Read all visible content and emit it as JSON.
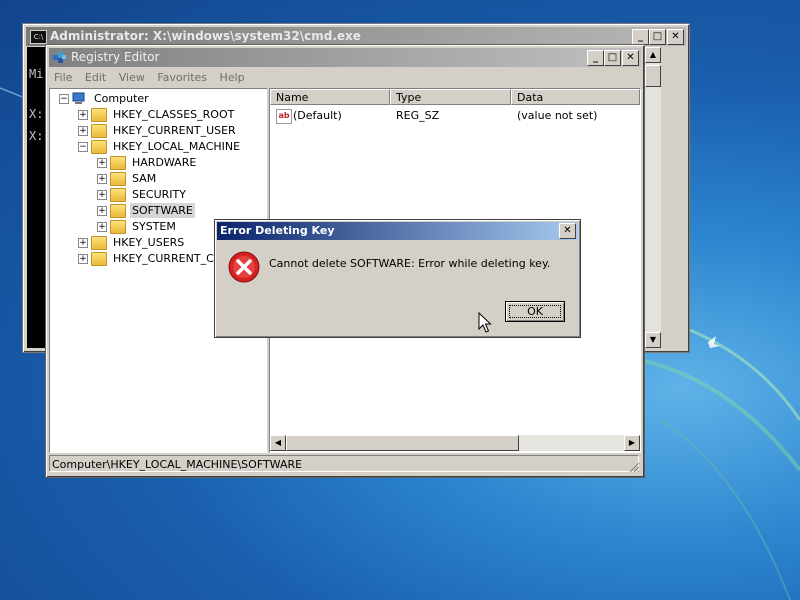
{
  "cmd": {
    "title": "Administrator: X:\\windows\\system32\\cmd.exe",
    "icon": "cmd-icon",
    "console_lines": [
      "Mi",
      "",
      "X:",
      "",
      "X:"
    ]
  },
  "regedit": {
    "title": "Registry Editor",
    "menu": [
      "File",
      "Edit",
      "View",
      "Favorites",
      "Help"
    ],
    "tree": [
      {
        "label": "Computer"
      },
      {
        "label": "HKEY_CLASSES_ROOT"
      },
      {
        "label": "HKEY_CURRENT_USER"
      },
      {
        "label": "HKEY_LOCAL_MACHINE"
      },
      {
        "label": "HARDWARE"
      },
      {
        "label": "SAM"
      },
      {
        "label": "SECURITY"
      },
      {
        "label": "SOFTWARE"
      },
      {
        "label": "SYSTEM"
      },
      {
        "label": "HKEY_USERS"
      },
      {
        "label": "HKEY_CURRENT_CONFIG"
      }
    ],
    "columns": [
      "Name",
      "Type",
      "Data"
    ],
    "values": [
      {
        "name": "(Default)",
        "type": "REG_SZ",
        "data": "(value not set)",
        "icon": "ab"
      }
    ],
    "status": "Computer\\HKEY_LOCAL_MACHINE\\SOFTWARE"
  },
  "dialog": {
    "title": "Error Deleting Key",
    "message": "Cannot delete SOFTWARE:  Error while deleting key.",
    "ok_label": "OK",
    "icon": "error-icon"
  },
  "window_buttons": {
    "minimize": "_",
    "maximize": "□",
    "close": "✕"
  },
  "colors": {
    "desktop": "#1a5fae",
    "dialog_title": "#0a246a",
    "error": "#d32020"
  }
}
